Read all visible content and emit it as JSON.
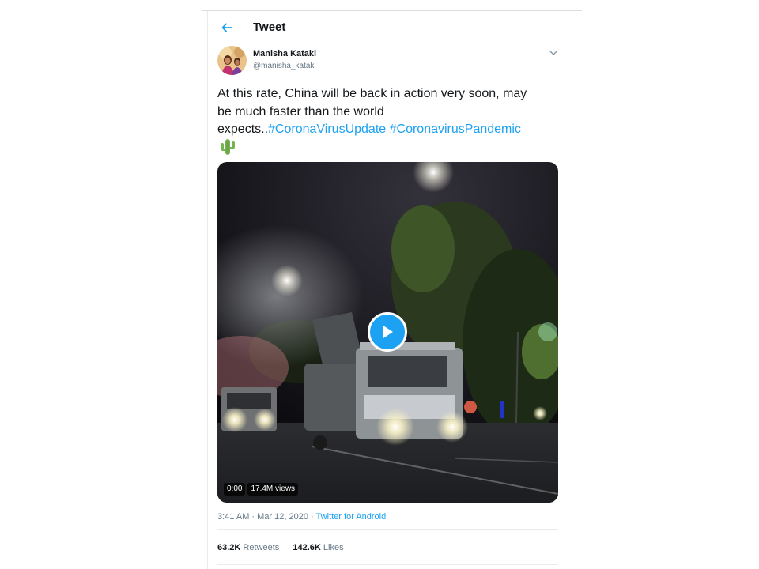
{
  "header": {
    "title": "Tweet",
    "back_icon": "arrow-left-icon"
  },
  "tweet": {
    "author_name": "Manisha Kataki",
    "author_handle": "@manisha_kataki",
    "text_line1": "At this rate, China will be back in action very soon, may",
    "text_line2": "be much faster than the world",
    "text_line3_prefix": "expects..",
    "hashtags": [
      "#CoronaVirusUpdate",
      "#CoronavirusPandemic"
    ],
    "emoji": "cactus-icon",
    "video": {
      "duration": "0:00",
      "views": "17.4M views",
      "play_icon": "play-icon"
    },
    "time": "3:41 AM",
    "date": "Mar 12, 2020",
    "separator": "·",
    "source": "Twitter for Android",
    "retweets_count": "63.2K",
    "retweets_label": "Retweets",
    "likes_count": "142.6K",
    "likes_label": "Likes"
  },
  "colors": {
    "accent": "#1da1f2",
    "text": "#14171a",
    "muted": "#657786",
    "border": "#e6ecf0"
  }
}
